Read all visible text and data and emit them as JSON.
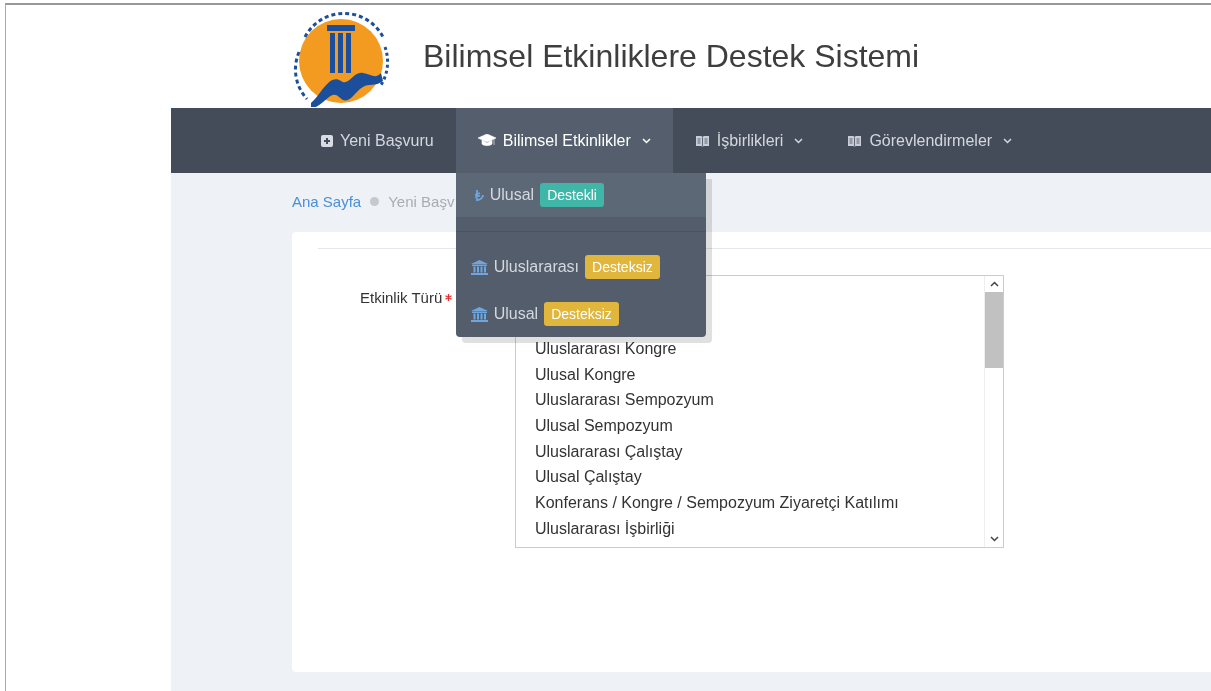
{
  "header": {
    "title": "Bilimsel Etkinliklere Destek Sistemi"
  },
  "nav": [
    {
      "label": "Yeni Başvuru",
      "kind": "new",
      "dropdown": false,
      "selected": false
    },
    {
      "label": "Bilimsel Etkinlikler",
      "kind": "events",
      "dropdown": true,
      "selected": true
    },
    {
      "label": "İşbirlikleri",
      "kind": "book",
      "dropdown": true,
      "selected": false
    },
    {
      "label": "Görevlendirmeler",
      "kind": "book",
      "dropdown": true,
      "selected": false
    }
  ],
  "menu": [
    {
      "label": "Ulusal",
      "badge": "Destekli",
      "kind": "supported",
      "selected": true
    },
    {
      "label": "Uluslararası",
      "badge": "Desteksiz",
      "kind": "unsupported",
      "selected": false
    },
    {
      "label": "Ulusal",
      "badge": "Desteksiz",
      "kind": "unsupported",
      "selected": false
    }
  ],
  "breadcrumb": [
    {
      "label": "Ana Sayfa",
      "kind": "link"
    },
    {
      "label": "Yeni Başv",
      "kind": "current"
    }
  ],
  "form": {
    "label": "Etkinlik Türü",
    "required": true,
    "options": [
      "Uluslararası Kongre",
      "Ulusal Kongre",
      "Uluslararası Sempozyum",
      "Ulusal Sempozyum",
      "Uluslararası Çalıştay",
      "Ulusal Çalıştay",
      "Konferans / Kongre / Sempozyum Ziyaretçi Katılımı",
      "Uluslararası İşbirliği"
    ]
  }
}
